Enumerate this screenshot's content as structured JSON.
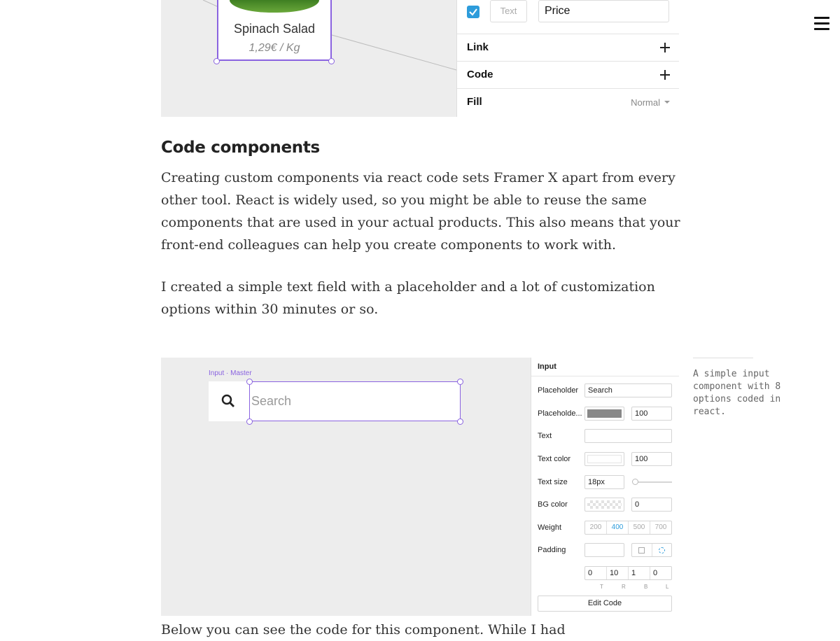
{
  "menu": {
    "icon": "hamburger-menu-icon"
  },
  "figure1": {
    "card": {
      "name": "Spinach Salad",
      "price": "1,29€ / Kg"
    },
    "panel": {
      "text_chip": "Text",
      "price_value": "Price",
      "rows": [
        {
          "label": "Link",
          "icon": "plus-icon"
        },
        {
          "label": "Code",
          "icon": "plus-icon"
        },
        {
          "label": "Fill",
          "value": "Normal"
        }
      ]
    }
  },
  "article": {
    "heading": "Code components",
    "paragraphs": [
      "Creating custom components via react code sets Framer X apart from every other tool. React is widely used, so you might be able to reuse the same components that are used in your actual products. This also means that your front-end colleagues can help you create components to work with.",
      "I created a simple text field with a placeholder and a lot of customization options within 30 minutes or so."
    ],
    "trailing": "Below you can see the code for this component. While I had"
  },
  "figure2": {
    "canvas_label": "Input · Master",
    "search_placeholder": "Search",
    "panel": {
      "title": "Input",
      "placeholder_label": "Placeholder",
      "placeholder_value": "Search",
      "placeholder_color_label": "Placeholde...",
      "placeholder_opacity": "100",
      "text_label": "Text",
      "text_color_label": "Text color",
      "text_color_opacity": "100",
      "text_size_label": "Text size",
      "text_size_value": "18px",
      "bg_color_label": "BG color",
      "bg_color_value": "0",
      "weight_label": "Weight",
      "weights": [
        "200",
        "400",
        "500",
        "700"
      ],
      "padding_label": "Padding",
      "padding_values": [
        "0",
        "10",
        "1",
        "0"
      ],
      "padding_sides": [
        "T",
        "R",
        "B",
        "L"
      ],
      "edit_code": "Edit Code"
    },
    "caption": "A simple input component with 8 options coded in react."
  },
  "colors": {
    "accent": "#8a63e0",
    "checkbox": "#2d9cdb",
    "weight_active": "#2d9cdb"
  }
}
